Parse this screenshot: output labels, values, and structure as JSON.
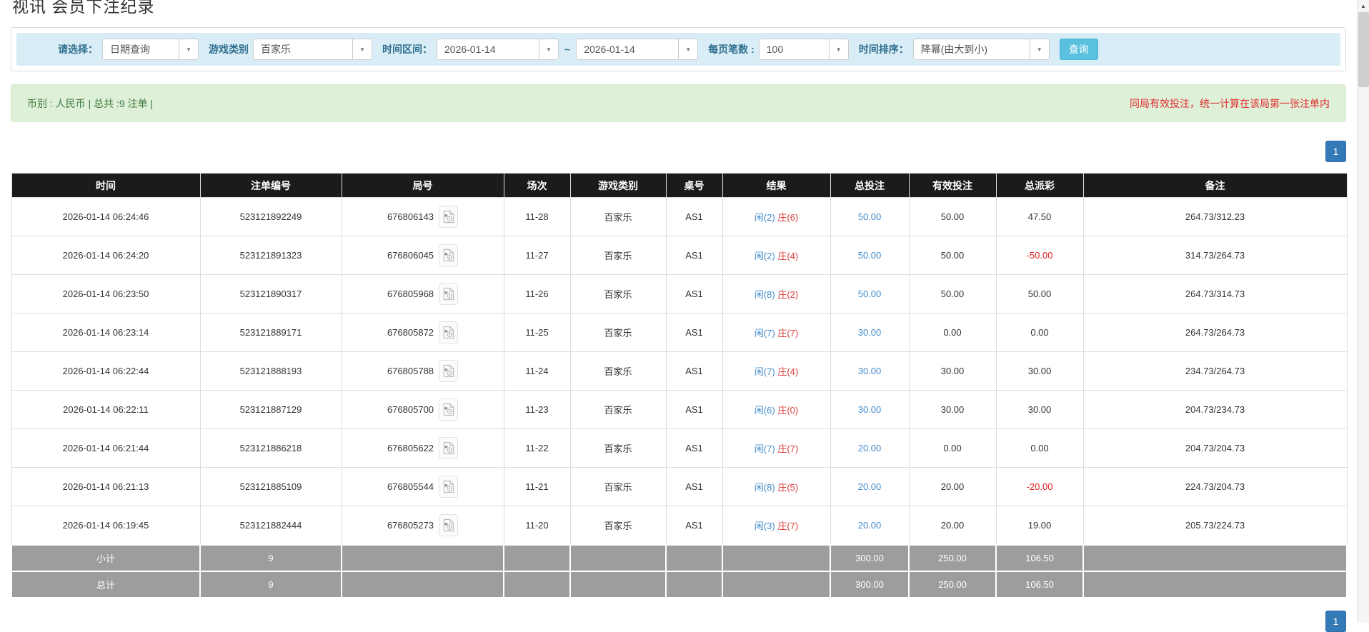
{
  "page": {
    "title": "视讯 会员下注纪录"
  },
  "filters": {
    "select_label": "请选择：",
    "select_value": "日期查询",
    "game_label": "游戏类别",
    "game_value": "百家乐",
    "range_label": "时间区间：",
    "date_from": "2026-01-14",
    "range_separator": "~",
    "date_to": "2026-01-14",
    "page_size_label": "每页笔数 :",
    "page_size_value": "100",
    "sort_label": "时间排序：",
    "sort_value": "降幂(由大到小)",
    "search_button": "查询"
  },
  "summary": {
    "left_text": "币别 : 人民币 | 总共 :9 注单 |",
    "right_note": "同局有效投注，统一计算在该局第一张注单内"
  },
  "pagination": {
    "page": "1"
  },
  "colors": {
    "accent_blue": "#428bca",
    "result_red": "#d9413d",
    "negative_red": "#e02020",
    "header_bg": "#1b1b1b",
    "sum_row_bg": "#9d9d9d",
    "info_bg": "#dff0d8",
    "filter_bg": "#d9edf7",
    "search_btn_bg": "#5bc0de",
    "page_btn_bg": "#337ab7"
  },
  "table": {
    "headers": [
      "时间",
      "注单编号",
      "局号",
      "场次",
      "游戏类别",
      "桌号",
      "结果",
      "总投注",
      "有效投注",
      "总派彩",
      "备注"
    ],
    "rows": [
      {
        "time": "2026-01-14 06:24:46",
        "bet_id": "523121892249",
        "round": "676806143",
        "session": "11-28",
        "game": "百家乐",
        "table_no": "AS1",
        "player": "闲(2)",
        "banker": "庄(6)",
        "total_bet": "50.00",
        "valid_bet": "50.00",
        "payout": "47.50",
        "remark": "264.73/312.23"
      },
      {
        "time": "2026-01-14 06:24:20",
        "bet_id": "523121891323",
        "round": "676806045",
        "session": "11-27",
        "game": "百家乐",
        "table_no": "AS1",
        "player": "闲(2)",
        "banker": "庄(4)",
        "total_bet": "50.00",
        "valid_bet": "50.00",
        "payout": "-50.00",
        "remark": "314.73/264.73"
      },
      {
        "time": "2026-01-14 06:23:50",
        "bet_id": "523121890317",
        "round": "676805968",
        "session": "11-26",
        "game": "百家乐",
        "table_no": "AS1",
        "player": "闲(8)",
        "banker": "庄(2)",
        "total_bet": "50.00",
        "valid_bet": "50.00",
        "payout": "50.00",
        "remark": "264.73/314.73"
      },
      {
        "time": "2026-01-14 06:23:14",
        "bet_id": "523121889171",
        "round": "676805872",
        "session": "11-25",
        "game": "百家乐",
        "table_no": "AS1",
        "player": "闲(7)",
        "banker": "庄(7)",
        "total_bet": "30.00",
        "valid_bet": "0.00",
        "payout": "0.00",
        "remark": "264.73/264.73"
      },
      {
        "time": "2026-01-14 06:22:44",
        "bet_id": "523121888193",
        "round": "676805788",
        "session": "11-24",
        "game": "百家乐",
        "table_no": "AS1",
        "player": "闲(7)",
        "banker": "庄(4)",
        "total_bet": "30.00",
        "valid_bet": "30.00",
        "payout": "30.00",
        "remark": "234.73/264.73"
      },
      {
        "time": "2026-01-14 06:22:11",
        "bet_id": "523121887129",
        "round": "676805700",
        "session": "11-23",
        "game": "百家乐",
        "table_no": "AS1",
        "player": "闲(6)",
        "banker": "庄(0)",
        "total_bet": "30.00",
        "valid_bet": "30.00",
        "payout": "30.00",
        "remark": "204.73/234.73"
      },
      {
        "time": "2026-01-14 06:21:44",
        "bet_id": "523121886218",
        "round": "676805622",
        "session": "11-22",
        "game": "百家乐",
        "table_no": "AS1",
        "player": "闲(7)",
        "banker": "庄(7)",
        "total_bet": "20.00",
        "valid_bet": "0.00",
        "payout": "0.00",
        "remark": "204.73/204.73"
      },
      {
        "time": "2026-01-14 06:21:13",
        "bet_id": "523121885109",
        "round": "676805544",
        "session": "11-21",
        "game": "百家乐",
        "table_no": "AS1",
        "player": "闲(8)",
        "banker": "庄(5)",
        "total_bet": "20.00",
        "valid_bet": "20.00",
        "payout": "-20.00",
        "remark": "224.73/204.73"
      },
      {
        "time": "2026-01-14 06:19:45",
        "bet_id": "523121882444",
        "round": "676805273",
        "session": "11-20",
        "game": "百家乐",
        "table_no": "AS1",
        "player": "闲(3)",
        "banker": "庄(7)",
        "total_bet": "20.00",
        "valid_bet": "20.00",
        "payout": "19.00",
        "remark": "205.73/224.73"
      }
    ],
    "subtotal": {
      "label": "小计",
      "count": "9",
      "total_bet": "300.00",
      "valid_bet": "250.00",
      "payout": "106.50"
    },
    "total": {
      "label": "总计",
      "count": "9",
      "total_bet": "300.00",
      "valid_bet": "250.00",
      "payout": "106.50"
    }
  }
}
